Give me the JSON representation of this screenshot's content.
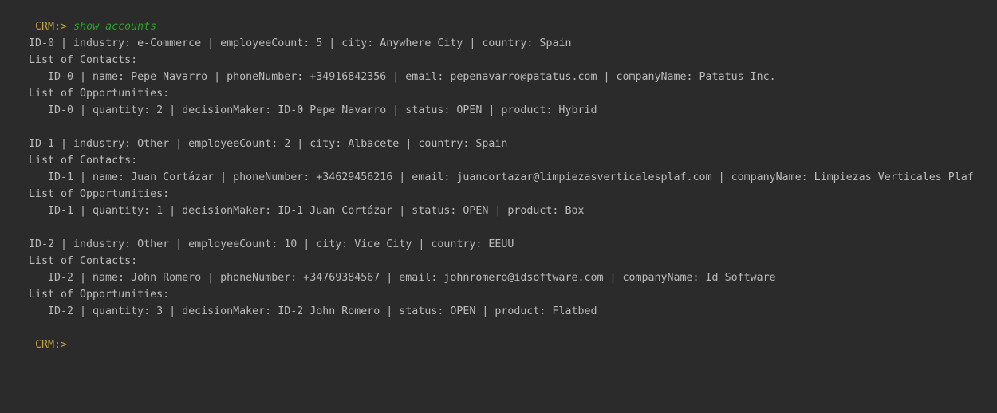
{
  "prompt": "CRM:>",
  "command": "show accounts",
  "colors": {
    "background": "#2b2b2b",
    "text": "#bbbbbb",
    "prompt": "#c2a243",
    "command": "#2aa12a"
  },
  "contacts_header": "List of Contacts:",
  "opportunities_header": "List of Opportunities:",
  "accounts": [
    {
      "summary": "ID-0 | industry: e-Commerce | employeeCount: 5 | city: Anywhere City | country: Spain",
      "contact": "ID-0 | name: Pepe Navarro | phoneNumber: +34916842356 | email: pepenavarro@patatus.com | companyName: Patatus Inc.",
      "opportunity": "ID-0 | quantity: 2 | decisionMaker: ID-0 Pepe Navarro | status: OPEN | product: Hybrid"
    },
    {
      "summary": "ID-1 | industry: Other | employeeCount: 2 | city: Albacete | country: Spain",
      "contact": "ID-1 | name: Juan Cortázar | phoneNumber: +34629456216 | email: juancortazar@limpiezasverticalesplaf.com | companyName: Limpiezas Verticales Plaf",
      "opportunity": "ID-1 | quantity: 1 | decisionMaker: ID-1 Juan Cortázar | status: OPEN | product: Box"
    },
    {
      "summary": "ID-2 | industry: Other | employeeCount: 10 | city: Vice City | country: EEUU",
      "contact": "ID-2 | name: John Romero | phoneNumber: +34769384567 | email: johnromero@idsoftware.com | companyName: Id Software",
      "opportunity": "ID-2 | quantity: 3 | decisionMaker: ID-2 John Romero | status: OPEN | product: Flatbed"
    }
  ]
}
